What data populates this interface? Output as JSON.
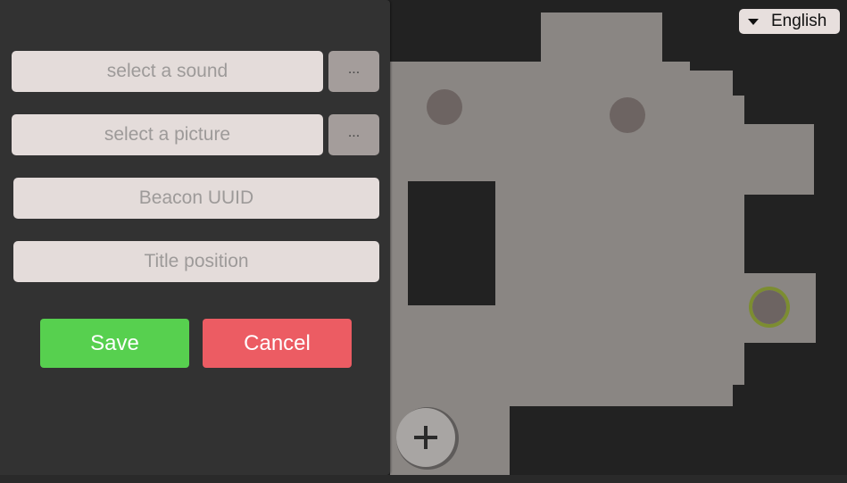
{
  "language": {
    "selected": "English",
    "caret_icon": "caret-down-icon"
  },
  "form": {
    "sound": {
      "placeholder": "select a sound",
      "browse_label": "..."
    },
    "picture": {
      "placeholder": "select a picture",
      "browse_label": "..."
    },
    "beacon_uuid": {
      "placeholder": "Beacon UUID"
    },
    "title_position": {
      "placeholder": "Title position"
    },
    "save_label": "Save",
    "cancel_label": "Cancel"
  },
  "map": {
    "add_icon": "plus-icon",
    "floor_color": "#8a8683",
    "background_color": "#222222",
    "marker_color": "#6d6462",
    "selected_marker_ring_color": "#7c8d31"
  },
  "colors": {
    "save": "#57d04f",
    "cancel": "#ec5c63",
    "panel": "#323232",
    "field": "#e4dcda"
  }
}
